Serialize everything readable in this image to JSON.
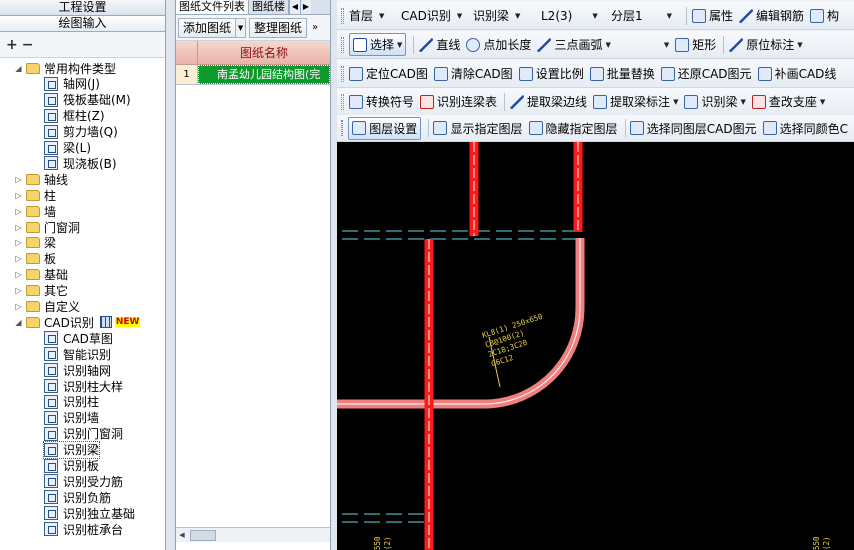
{
  "left_panel": {
    "header_project": "工程设置",
    "header_drawing": "绘图输入",
    "tree": [
      {
        "label": "常用构件类型",
        "level": 0,
        "kind": "folder",
        "expanded": true
      },
      {
        "label": "轴网(J)",
        "level": 1,
        "kind": "axis-grid-icon"
      },
      {
        "label": "筏板基础(M)",
        "level": 1,
        "kind": "raft-foundation-icon"
      },
      {
        "label": "框柱(Z)",
        "level": 1,
        "kind": "frame-column-icon"
      },
      {
        "label": "剪力墙(Q)",
        "level": 1,
        "kind": "shear-wall-icon"
      },
      {
        "label": "梁(L)",
        "level": 1,
        "kind": "beam-icon"
      },
      {
        "label": "现浇板(B)",
        "level": 1,
        "kind": "cast-slab-icon"
      },
      {
        "label": "轴线",
        "level": 0,
        "kind": "folder"
      },
      {
        "label": "柱",
        "level": 0,
        "kind": "folder"
      },
      {
        "label": "墙",
        "level": 0,
        "kind": "folder"
      },
      {
        "label": "门窗洞",
        "level": 0,
        "kind": "folder"
      },
      {
        "label": "梁",
        "level": 0,
        "kind": "folder"
      },
      {
        "label": "板",
        "level": 0,
        "kind": "folder"
      },
      {
        "label": "基础",
        "level": 0,
        "kind": "folder"
      },
      {
        "label": "其它",
        "level": 0,
        "kind": "folder"
      },
      {
        "label": "自定义",
        "level": 0,
        "kind": "folder"
      },
      {
        "label": "CAD识别",
        "level": 0,
        "kind": "folder",
        "expanded": true,
        "badge": "NEW"
      },
      {
        "label": "CAD草图",
        "level": 1,
        "kind": "cad-sketch-icon"
      },
      {
        "label": "智能识别",
        "level": 1,
        "kind": "smart-recognize-icon"
      },
      {
        "label": "识别轴网",
        "level": 1,
        "kind": "recognize-axis-icon"
      },
      {
        "label": "识别柱大样",
        "level": 1,
        "kind": "recognize-column-detail-icon"
      },
      {
        "label": "识别柱",
        "level": 1,
        "kind": "recognize-column-icon"
      },
      {
        "label": "识别墙",
        "level": 1,
        "kind": "recognize-wall-icon"
      },
      {
        "label": "识别门窗洞",
        "level": 1,
        "kind": "recognize-opening-icon"
      },
      {
        "label": "识别梁",
        "level": 1,
        "kind": "recognize-beam-icon",
        "selected": true
      },
      {
        "label": "识别板",
        "level": 1,
        "kind": "recognize-slab-icon"
      },
      {
        "label": "识别受力筋",
        "level": 1,
        "kind": "recognize-main-rebar-icon"
      },
      {
        "label": "识别负筋",
        "level": 1,
        "kind": "recognize-negative-rebar-icon"
      },
      {
        "label": "识别独立基础",
        "level": 1,
        "kind": "recognize-isolated-foundation-icon"
      },
      {
        "label": "识别桩承台",
        "level": 1,
        "kind": "recognize-pile-cap-icon"
      }
    ]
  },
  "middle_panel": {
    "tabs": [
      "图纸文件列表",
      "图纸楼"
    ],
    "buttons": {
      "add": "添加图纸",
      "organize": "整理图纸",
      "more": "»"
    },
    "table": {
      "header": "图纸名称",
      "rows": [
        {
          "index": "1",
          "name": "南孟幼儿园结构图(完"
        }
      ]
    }
  },
  "toolbar": {
    "row1": {
      "floor": "首层",
      "cad_recognize": "CAD识别",
      "recognize_beam": "识别梁",
      "layer_beam": "L2(3)",
      "sublayer": "分层1",
      "properties": "属性",
      "edit_rebar": "编辑钢筋",
      "truncated": "构"
    },
    "row2": {
      "select": "选择",
      "line": "直线",
      "point_length": "点加长度",
      "three_point_arc": "三点画弧",
      "rectangle": "矩形",
      "in_situ_mark": "原位标注"
    },
    "row3": {
      "locate_cad": "定位CAD图",
      "clear_cad": "清除CAD图",
      "set_scale": "设置比例",
      "batch_replace": "批量替换",
      "restore_cad": "还原CAD图元",
      "supplement_cad": "补画CAD线"
    },
    "row4": {
      "convert_symbol": "转换符号",
      "recognize_continuous_beam_table": "识别连梁表",
      "extract_beam_edge": "提取梁边线",
      "extract_beam_mark": "提取梁标注",
      "recognize_beam": "识别梁",
      "check_support": "查改支座"
    },
    "row5": {
      "layer_settings": "图层设置",
      "show_layer": "显示指定图层",
      "hide_layer": "隐藏指定图层",
      "select_same_layer": "选择同图层CAD图元",
      "select_same_color": "选择同颜色C"
    }
  },
  "canvas": {
    "annotation": [
      "KL8(1) 250x650",
      "C8@100(2)",
      "2C18;3C20",
      "G6C12"
    ],
    "bottom_labels": [
      "550",
      "(2)"
    ],
    "colors": {
      "background": "#000000",
      "beam_red": "#ff1a1a",
      "beam_pink": "#f08080",
      "axis_cyan": "#5fd7e8",
      "annotation_yellow": "#e8d24a"
    }
  }
}
